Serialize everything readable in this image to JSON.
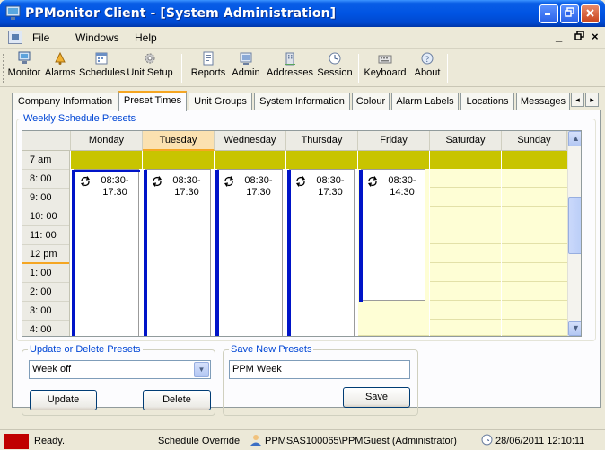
{
  "window": {
    "title": "PPMonitor Client - [System Administration]"
  },
  "menu": {
    "items": [
      "File",
      "Windows",
      "Help"
    ],
    "mdi_min": "_",
    "mdi_restore": "ฅ",
    "mdi_close": "x"
  },
  "toolbar": {
    "buttons": [
      {
        "label": "Monitor",
        "icon": "monitor-icon"
      },
      {
        "label": "Alarms",
        "icon": "alarm-bell-icon"
      },
      {
        "label": "Schedules",
        "icon": "schedules-calendar-icon"
      },
      {
        "label": "Unit Setup",
        "icon": "gear-icon"
      },
      {
        "label": "Reports",
        "icon": "report-document-icon"
      },
      {
        "label": "Admin",
        "icon": "admin-icon"
      },
      {
        "label": "Addresses",
        "icon": "addresses-building-icon"
      },
      {
        "label": "Session",
        "icon": "session-clock-icon"
      },
      {
        "label": "Keyboard",
        "icon": "keyboard-icon"
      },
      {
        "label": "About",
        "icon": "about-info-icon"
      }
    ]
  },
  "tabs": {
    "items": [
      "Company Information",
      "Preset Times",
      "Unit Groups",
      "System Information",
      "Colour",
      "Alarm Labels",
      "Locations",
      "Messages"
    ],
    "active": "Preset Times"
  },
  "weekly": {
    "label": "Weekly Schedule Presets",
    "days": [
      "Monday",
      "Tuesday",
      "Wednesday",
      "Thursday",
      "Friday",
      "Saturday",
      "Sunday"
    ],
    "today": "Tuesday",
    "times": [
      "7  am",
      "8:  00",
      "9:  00",
      "10:  00",
      "11:  00",
      "12  pm",
      "1:  00",
      "2:  00",
      "3:  00",
      "4:  00"
    ],
    "entries": [
      {
        "day": "Monday",
        "start": "08:30-",
        "end": "17:30"
      },
      {
        "day": "Tuesday",
        "start": "08:30-",
        "end": "17:30"
      },
      {
        "day": "Wednesday",
        "start": "08:30-",
        "end": "17:30"
      },
      {
        "day": "Thursday",
        "start": "08:30-",
        "end": "17:30"
      },
      {
        "day": "Friday",
        "start": "08:30-",
        "end": "14:30"
      }
    ]
  },
  "update_group": {
    "label": "Update or Delete Presets",
    "selected": "Week off",
    "update": "Update",
    "delete": "Delete"
  },
  "save_group": {
    "label": "Save New Presets",
    "name_value": "PPM Week",
    "save": "Save"
  },
  "status": {
    "text": "Ready.",
    "override": "Schedule Override",
    "user": "PPMSAS100065\\PPMGuest (Administrator)",
    "datetime": "28/06/2011 12:10:11"
  },
  "colors": {
    "accent": "#f5a623",
    "schedule_bar": "#0014c8",
    "band": "#c8c400",
    "title": "#0054e3"
  }
}
